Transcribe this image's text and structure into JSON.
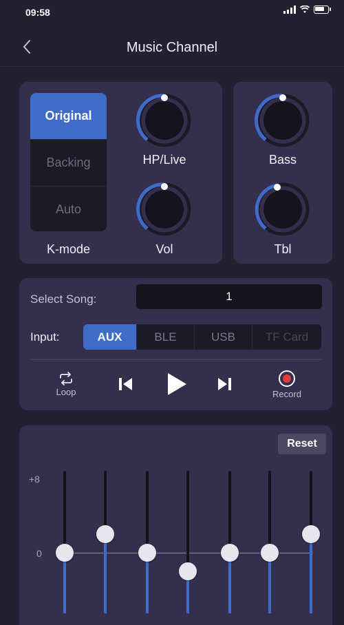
{
  "status_bar": {
    "time": "09:58"
  },
  "header": {
    "title": "Music Channel"
  },
  "kmode": {
    "items": [
      "Original",
      "Backing",
      "Auto"
    ],
    "selected": "Original",
    "label": "K-mode"
  },
  "knobs": {
    "hp_live": {
      "label": "HP/Live"
    },
    "vol": {
      "label": "Vol"
    },
    "bass": {
      "label": "Bass"
    },
    "tbl": {
      "label": "Tbl"
    }
  },
  "song": {
    "label": "Select Song:",
    "value": "1"
  },
  "input": {
    "label": "Input:",
    "options": [
      "AUX",
      "BLE",
      "USB",
      "TF Card"
    ],
    "selected": "AUX"
  },
  "transport": {
    "loop_label": "Loop",
    "record_label": "Record"
  },
  "eq": {
    "reset_label": "Reset",
    "scale_top": "+8",
    "scale_zero": "0",
    "bands": [
      0,
      2,
      0,
      -2,
      0,
      0,
      2
    ]
  },
  "colors": {
    "accent": "#3f6cc9",
    "panel": "#352f4e",
    "background": "#232031",
    "record": "#e23b3b"
  }
}
